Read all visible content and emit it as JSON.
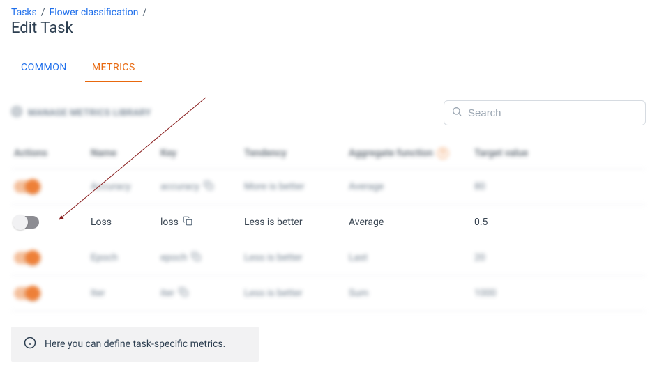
{
  "breadcrumb": {
    "root": "Tasks",
    "mid": "Flower classification",
    "sep": "/"
  },
  "page_title": "Edit Task",
  "tabs": {
    "common": "COMMON",
    "metrics": "METRICS"
  },
  "toolbar": {
    "manage_library": "MANAGE METRICS LIBRARY",
    "search_placeholder": "Search"
  },
  "help_glyph": "?",
  "columns": {
    "actions": "Actions",
    "name": "Name",
    "key": "Key",
    "tendency": "Tendency",
    "aggfn": "Aggregate function",
    "target": "Target value"
  },
  "rows": [
    {
      "on": true,
      "name": "Accuracy",
      "key": "accuracy",
      "tendency": "More is better",
      "aggfn": "Average",
      "target": "80",
      "focus": false
    },
    {
      "on": false,
      "name": "Loss",
      "key": "loss",
      "tendency": "Less is better",
      "aggfn": "Average",
      "target": "0.5",
      "focus": true
    },
    {
      "on": true,
      "name": "Epoch",
      "key": "epoch",
      "tendency": "Less is better",
      "aggfn": "Last",
      "target": "20",
      "focus": false
    },
    {
      "on": true,
      "name": "Iter",
      "key": "iter",
      "tendency": "Less is better",
      "aggfn": "Sum",
      "target": "1000",
      "focus": false
    }
  ],
  "infobar": "Here you can define task-specific metrics."
}
